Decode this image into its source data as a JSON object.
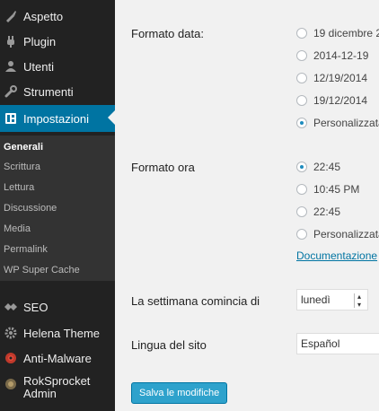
{
  "sidebar": {
    "items": [
      {
        "label": "Aspetto",
        "icon": "paintbrush-icon"
      },
      {
        "label": "Plugin",
        "icon": "plug-icon"
      },
      {
        "label": "Utenti",
        "icon": "users-icon"
      },
      {
        "label": "Strumenti",
        "icon": "wrench-icon"
      },
      {
        "label": "Impostazioni",
        "icon": "settings-icon"
      }
    ],
    "submenu": [
      "Generali",
      "Scrittura",
      "Lettura",
      "Discussione",
      "Media",
      "Permalink",
      "WP Super Cache"
    ],
    "plugins": [
      {
        "label": "SEO",
        "icon": "seo-icon"
      },
      {
        "label": "Helena Theme",
        "icon": "gear-icon"
      },
      {
        "label": "Anti-Malware",
        "icon": "malware-icon"
      },
      {
        "label_line1": "RokSprocket",
        "label_line2": "Admin",
        "icon": "rocket-icon"
      }
    ]
  },
  "main": {
    "date_format": {
      "label": "Formato data:",
      "options": [
        "19 dicembre 2",
        "2014-12-19",
        "12/19/2014",
        "19/12/2014",
        "Personalizzata"
      ],
      "selected_index": 4
    },
    "time_format": {
      "label": "Formato ora",
      "options": [
        "22:45",
        "10:45 PM",
        "22:45",
        "Personalizzata"
      ],
      "selected_index": 0
    },
    "documentation_link": "Documentazione",
    "week_start": {
      "label": "La settimana comincia di",
      "value": "lunedì"
    },
    "site_language": {
      "label": "Lingua del sito",
      "value": "Español"
    },
    "save_button": "Salva le modifiche"
  },
  "colors": {
    "sidebar_bg": "#222222",
    "submenu_bg": "#333333",
    "active_accent": "#0074a2",
    "button_bg": "#2ea2cc",
    "page_bg": "#f1f1f1"
  }
}
